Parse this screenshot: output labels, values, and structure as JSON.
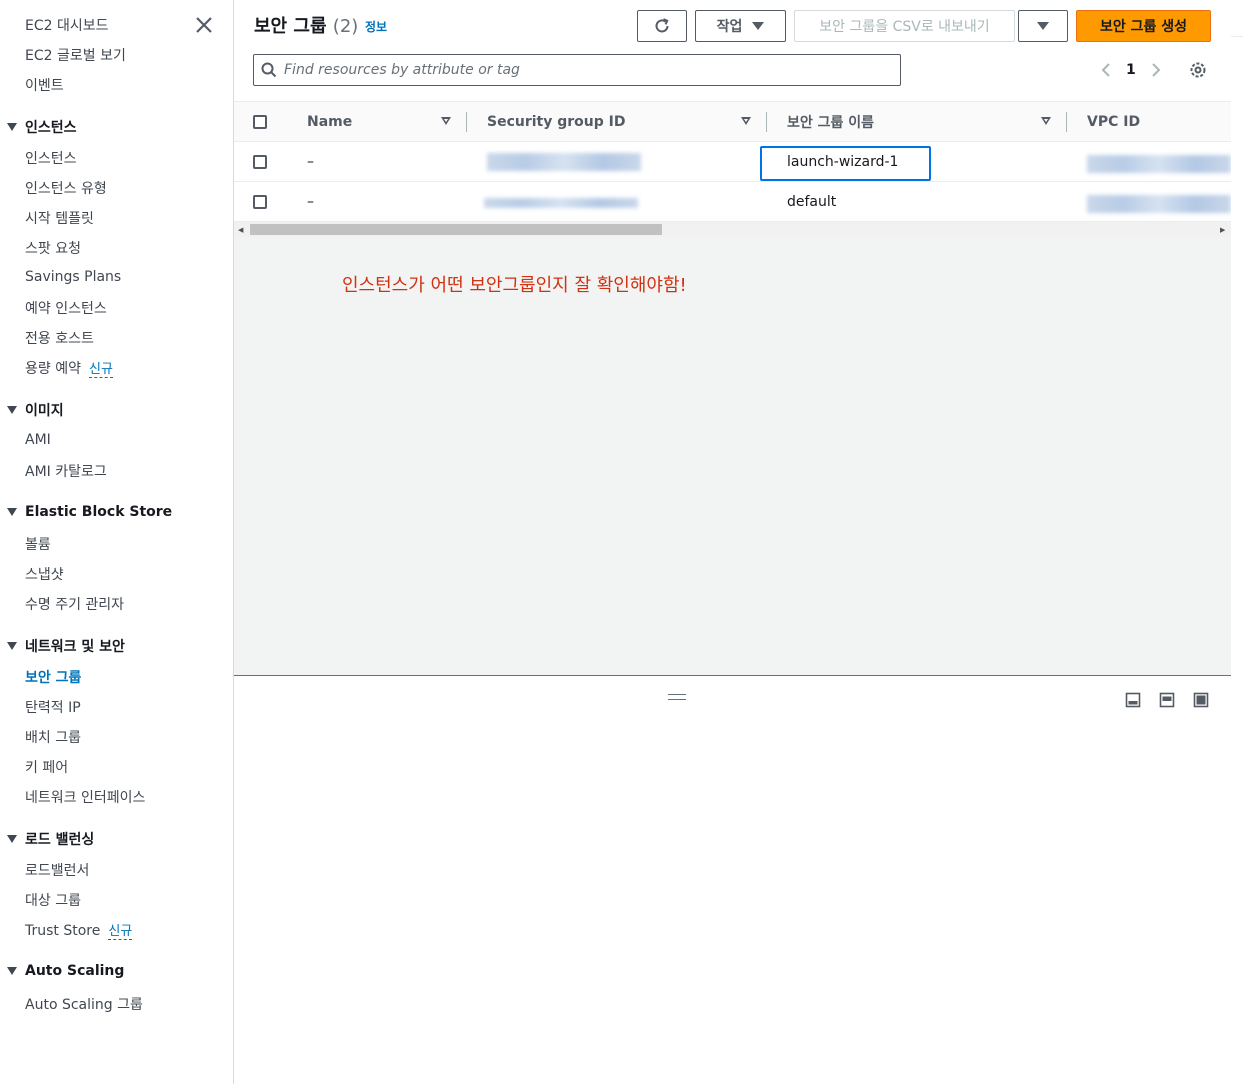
{
  "sidebar": {
    "top_items": [
      "EC2 대시보드",
      "EC2 글로벌 보기",
      "이벤트"
    ],
    "sections": {
      "instances": {
        "title": "인스턴스",
        "items": [
          "인스턴스",
          "인스턴스 유형",
          "시작 템플릿",
          "스팟 요청",
          "Savings Plans",
          "예약 인스턴스",
          "전용 호스트",
          "용량 예약"
        ]
      },
      "images": {
        "title": "이미지",
        "items": [
          "AMI",
          "AMI 카탈로그"
        ]
      },
      "ebs": {
        "title": "Elastic Block Store",
        "items": [
          "볼륨",
          "스냅샷",
          "수명 주기 관리자"
        ]
      },
      "network": {
        "title": "네트워크 및 보안",
        "items": [
          "보안 그룹",
          "탄력적 IP",
          "배치 그룹",
          "키 페어",
          "네트워크 인터페이스"
        ]
      },
      "lb": {
        "title": "로드 밸런싱",
        "items": [
          "로드밸런서",
          "대상 그룹",
          "Trust Store"
        ]
      },
      "autoscaling": {
        "title": "Auto Scaling",
        "items": [
          "Auto Scaling 그룹"
        ]
      }
    },
    "new_badge": "신규",
    "active_item": "보안 그룹"
  },
  "header": {
    "title": "보안 그룹",
    "count": "(2)",
    "info_link": "정보",
    "refresh_icon": "refresh-icon",
    "actions_label": "작업",
    "export_label": "보안 그룹을 CSV로 내보내기",
    "create_label": "보안 그룹 생성"
  },
  "search": {
    "placeholder": "Find resources by attribute or tag"
  },
  "pagination": {
    "current_page": "1"
  },
  "table": {
    "columns": [
      "Name",
      "Security group ID",
      "보안 그룹 이름",
      "VPC ID"
    ],
    "rows": [
      {
        "name": "–",
        "group_name": "launch-wizard-1"
      },
      {
        "name": "–",
        "group_name": "default"
      }
    ]
  },
  "annotation": "인스턴스가 어떤 보안그룹인지 잘 확인해야함!",
  "colors": {
    "accent": "#0073bb",
    "primary_button": "#ff9900",
    "annotation": "#d13212",
    "highlight_border": "#0073e6"
  }
}
